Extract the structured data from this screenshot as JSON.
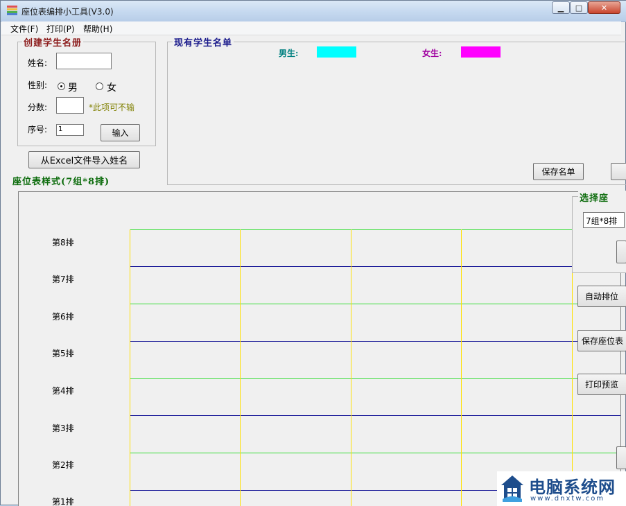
{
  "window": {
    "title": "座位表编排小工具(V3.0)",
    "controls": {
      "minimize": "▁",
      "maximize": "□",
      "close": "✕"
    }
  },
  "menu": [
    "文件(F)",
    "打印(P)",
    "帮助(H)"
  ],
  "create_group": {
    "title": "创建学生名册",
    "name_label": "姓名:",
    "name_value": "",
    "gender_label": "性别:",
    "male_label": "男",
    "female_label": "女",
    "selected_gender": "男",
    "score_label": "分数:",
    "score_value": "",
    "score_hint": "*此项可不输",
    "seq_label": "序号:",
    "seq_value": "1",
    "input_button": "输入"
  },
  "import_button": "从Excel文件导入姓名",
  "roster_group": {
    "title": "现有学生名单",
    "male_legend": "男生:",
    "female_legend": "女生:",
    "save_button": "保存名单"
  },
  "seat_style_title": "座位表样式(7组*8排)",
  "chart": {
    "rows": [
      "第8排",
      "第7排",
      "第6排",
      "第5排",
      "第4排",
      "第3排",
      "第2排",
      "第1排"
    ]
  },
  "side": {
    "group_title": "选择座",
    "layout_value": "7组*8排",
    "auto_button": "自动排位",
    "save_chart_button": "保存座位表",
    "print_preview_button": "打印预览"
  },
  "watermark": {
    "title": "电脑系统网",
    "url": "www.dnxtw.com"
  },
  "colors": {
    "male": "#00ffff",
    "female": "#ff00ff",
    "line_green": "#33dd33",
    "line_blue": "#1c1c99",
    "line_yellow": "#ffe100",
    "group_title_red": "#8b1a1a",
    "group_title_blue": "#1a1a8b",
    "group_title_green": "#0b6b0b",
    "hint_olive": "#808000"
  }
}
